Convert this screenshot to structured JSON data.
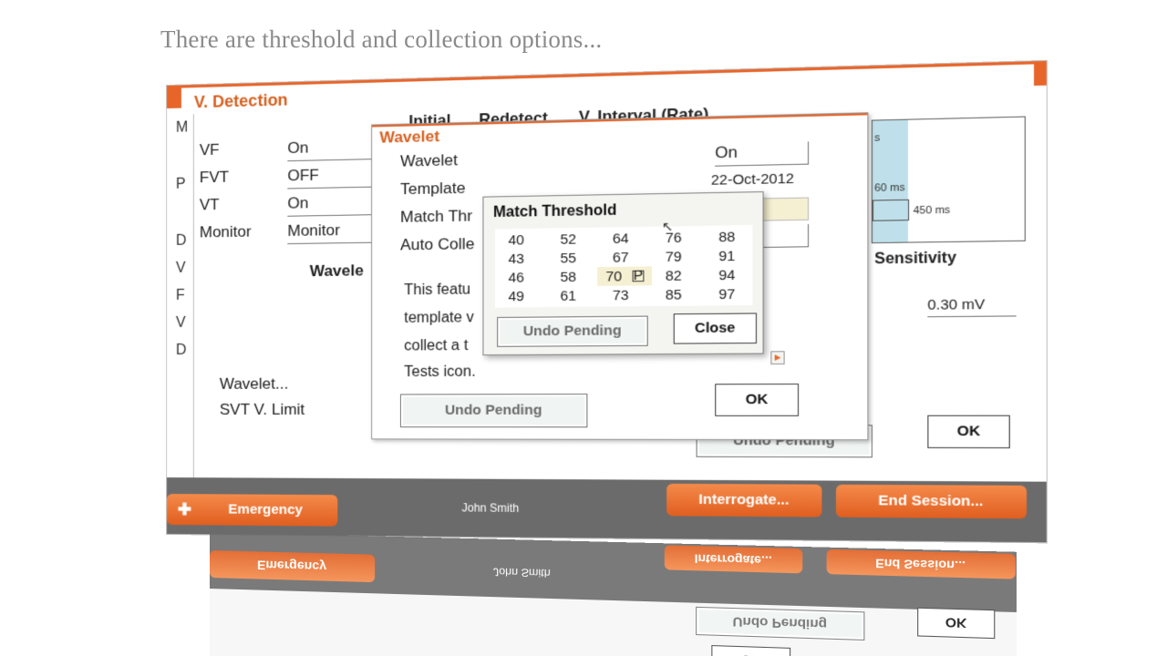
{
  "caption": "There are threshold and collection options...",
  "main_window": {
    "title": "V. Detection",
    "left_strip_letters": [
      "M",
      "P",
      "D",
      "V",
      "F",
      "V",
      "D"
    ],
    "column_headers": [
      "Initial",
      "Redetect",
      "V. Interval (Rate)"
    ],
    "zones": [
      {
        "label": "VF",
        "value": "On"
      },
      {
        "label": "FVT",
        "value": "OFF"
      },
      {
        "label": "VT",
        "value": "On"
      },
      {
        "label": "Monitor",
        "value": "Monitor"
      }
    ],
    "wavelet_heading": "Wavele",
    "wavelet_link": "Wavelet...",
    "svt_limit": "SVT V. Limit",
    "interval_60": "60 ms",
    "interval_450": "450 ms",
    "interval_s": "s",
    "sensitivity_label": "Sensitivity",
    "sensitivity_value": "0.30 mV",
    "undo_pending": "Undo Pending",
    "ok": "OK"
  },
  "wavelet_dialog": {
    "title": "Wavelet",
    "rows": [
      {
        "label": "Wavelet",
        "value": "On"
      },
      {
        "label": "Template",
        "value": "22-Oct-2012"
      },
      {
        "label": "Match Thr",
        "value": ""
      },
      {
        "label": "Auto Colle",
        "value": ""
      }
    ],
    "text_lines": [
      "This featu",
      "template v",
      "collect a t",
      "Tests icon."
    ],
    "undo_pending": "Undo Pending",
    "ok": "OK"
  },
  "match_threshold_dialog": {
    "title": "Match Threshold",
    "values": [
      [
        "40",
        "52",
        "64",
        "76",
        "88"
      ],
      [
        "43",
        "55",
        "67",
        "79",
        "91"
      ],
      [
        "46",
        "58",
        "70",
        "82",
        "94"
      ],
      [
        "49",
        "61",
        "73",
        "85",
        "97"
      ]
    ],
    "selected": "70",
    "pending_badge": "P",
    "undo_pending": "Undo Pending",
    "close": "Close"
  },
  "bottom_bar": {
    "emergency": "Emergency",
    "patient": "John Smith",
    "interrogate": "Interrogate...",
    "end_session": "End Session..."
  },
  "colors": {
    "accent": "#e8652a",
    "bar": "#6b6b6b",
    "highlight": "#f5f0d2"
  }
}
